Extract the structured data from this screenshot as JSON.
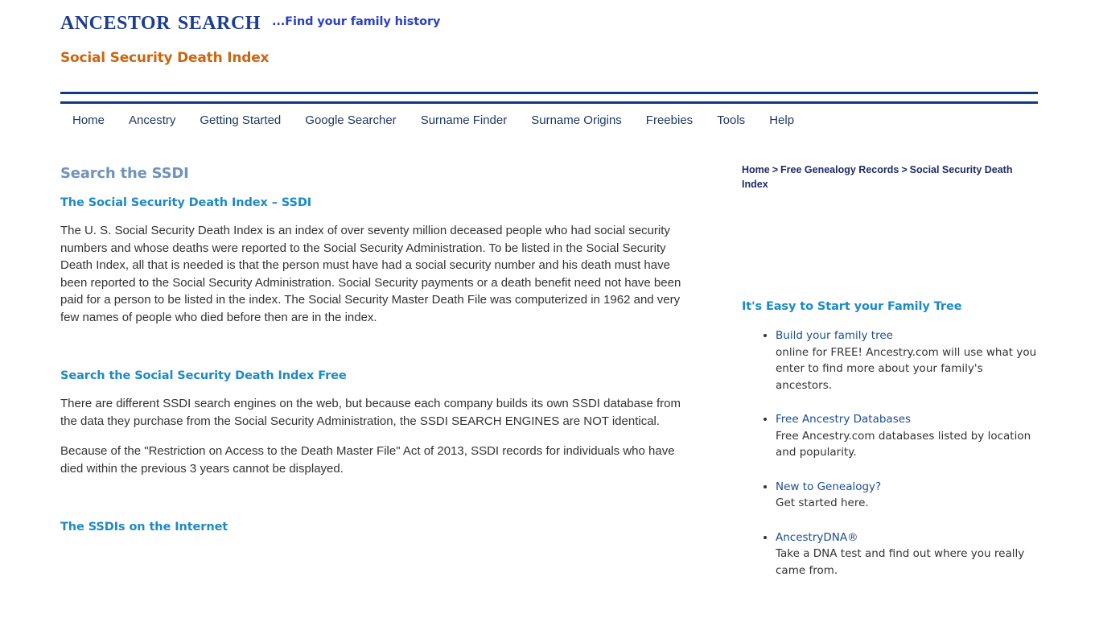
{
  "header": {
    "logo_title": "Ancestor Search",
    "logo_tagline": "...Find your family history",
    "subtitle": "Social Security Death Index",
    "brand_color": "#1c3d92",
    "tagline_color": "#2b3fc4",
    "subtitle_color": "#cc6611",
    "rule_color": "#123a7e"
  },
  "nav": {
    "items": [
      {
        "label": "Home"
      },
      {
        "label": "Ancestry"
      },
      {
        "label": "Getting Started"
      },
      {
        "label": "Google Searcher"
      },
      {
        "label": "Surname Finder"
      },
      {
        "label": "Surname Origins"
      },
      {
        "label": "Freebies"
      },
      {
        "label": "Tools"
      },
      {
        "label": "Help"
      }
    ]
  },
  "main": {
    "page_heading": "Search the SSDI",
    "section1": {
      "heading": "The Social Security Death Index – SSDI",
      "paragraph": "The U. S. Social Security Death Index is an index of over seventy million deceased people who had social security numbers and whose deaths were reported to the Social Security Administration. To be listed in the Social Security Death Index, all that is needed is that the person must have had a social security number and his death must have been reported to the Social Security Administration. Social Security payments or a death benefit need not have been paid for a person to be listed in the index. The Social Security Master Death File was computerized in 1962 and very few names of people who died before then are in the index."
    },
    "section2": {
      "heading": "Search the Social Security Death Index Free",
      "paragraph1": "There are different SSDI search engines on the web, but because each company builds its own SSDI database from the data they purchase from the Social Security Administration, the SSDI SEARCH ENGINES are NOT identical.",
      "paragraph2": "Because of the \"Restriction on Access to the Death Master File\" Act of 2013, SSDI records for individuals who have died within the previous 3 years cannot be displayed."
    },
    "section3": {
      "heading": "The SSDIs on the Internet"
    },
    "page_heading_color": "#6f93bd",
    "section_heading_color": "#1d8ac4"
  },
  "sidebar": {
    "breadcrumb": {
      "items": [
        {
          "label": "Home",
          "link": true
        },
        {
          "label": "Free Genealogy Records",
          "link": true
        },
        {
          "label": "Social Security Death Index",
          "link": false
        }
      ],
      "separator": ">"
    },
    "promo": {
      "heading": "It's Easy to Start your Family Tree",
      "items": [
        {
          "link": "Build your family tree",
          "desc": "online for FREE! Ancestry.com will use what you enter to find more about your family's ancestors."
        },
        {
          "link": "Free Ancestry Databases",
          "desc": "Free Ancestry.com databases listed by location and popularity."
        },
        {
          "link": "New to Genealogy?",
          "desc": "Get started here."
        },
        {
          "link": "AncestryDNA®",
          "desc": "Take a DNA test and find out where you really came from."
        }
      ],
      "link_color": "#1c4d8f",
      "heading_color": "#1d8ac4"
    }
  }
}
